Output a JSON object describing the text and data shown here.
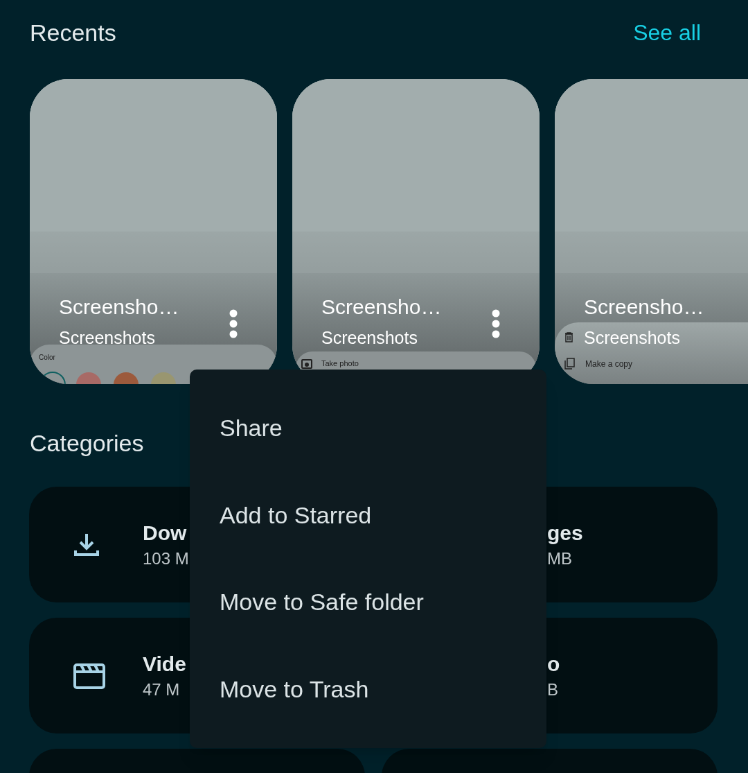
{
  "recents": {
    "title": "Recents",
    "see_all": "See all",
    "items": [
      {
        "title": "Screensho…",
        "subtitle": "Screenshots",
        "more_button": true,
        "preview": {
          "kind": "colors",
          "label": "Color"
        }
      },
      {
        "title": "Screensho…",
        "subtitle": "Screenshots",
        "more_button": true,
        "preview": {
          "kind": "camera",
          "label": "Take photo"
        }
      },
      {
        "title": "Screensho…",
        "subtitle": "Screenshots",
        "more_button": false,
        "preview": {
          "kind": "copy",
          "label": "Make a copy"
        }
      }
    ]
  },
  "categories": {
    "title": "Categories",
    "items": [
      {
        "kind": "download",
        "name": "Dow",
        "size": "103 M"
      },
      {
        "kind": "images",
        "name": "ges",
        "size": "MB"
      },
      {
        "kind": "video",
        "name": "Vide",
        "size": "47 M"
      },
      {
        "kind": "audio",
        "name": "o",
        "size": "B"
      },
      {
        "kind": "blank"
      },
      {
        "kind": "blank"
      }
    ]
  },
  "menu": {
    "items": [
      "Share",
      "Add to Starred",
      "Move to Safe folder",
      "Move to Trash"
    ]
  }
}
